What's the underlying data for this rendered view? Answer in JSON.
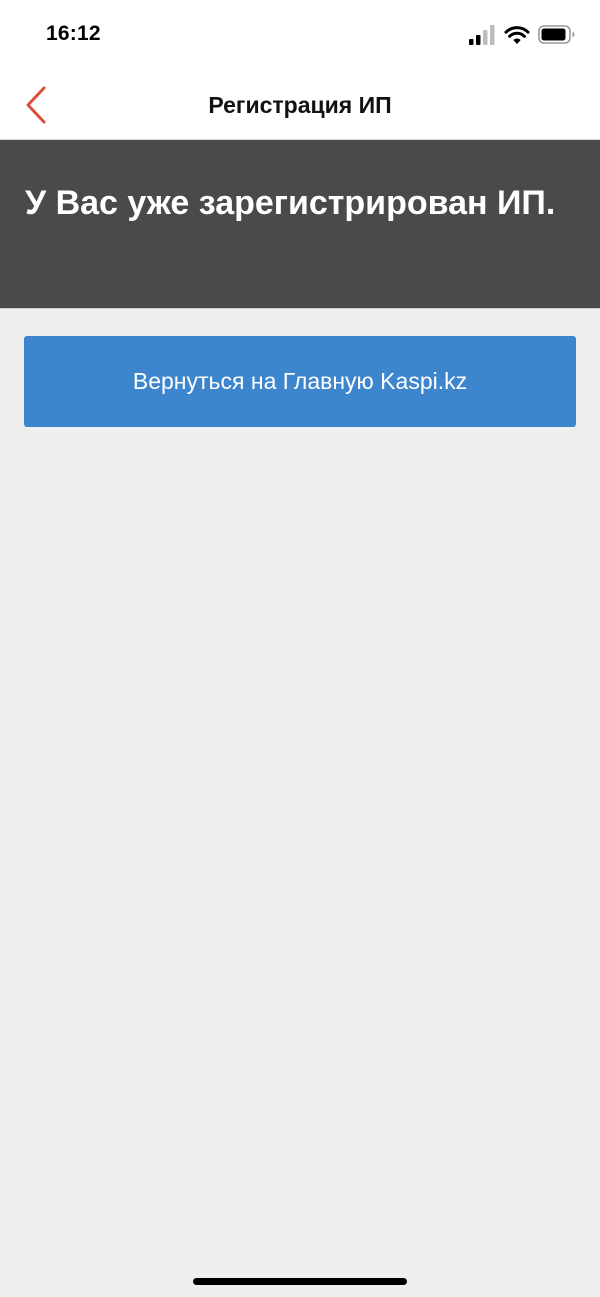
{
  "status_bar": {
    "time": "16:12",
    "icons": [
      "signal-icon",
      "wifi-icon",
      "battery-icon"
    ]
  },
  "nav": {
    "title": "Регистрация ИП",
    "back_icon": "chevron-left-icon"
  },
  "banner": {
    "message": "У Вас уже зарегистрирован ИП."
  },
  "actions": {
    "home_button_label": "Вернуться на Главную Kaspi.kz"
  },
  "colors": {
    "accent_back": "#d9503a",
    "banner_bg": "#4a4a4a",
    "button_bg": "#3d86cd",
    "page_bg": "#efefef"
  }
}
